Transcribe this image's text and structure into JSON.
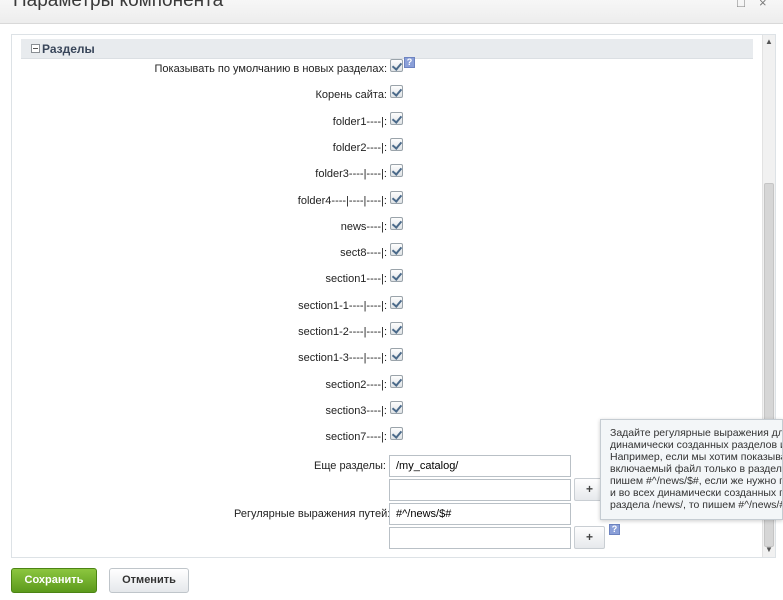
{
  "window": {
    "title": "Параметры компонента",
    "minimize_glyph": "□",
    "close_glyph": "×"
  },
  "section": {
    "title": "Разделы"
  },
  "checkbox_rows": [
    {
      "label": "Показывать по умолчанию в новых разделах:",
      "checked": true
    },
    {
      "label": "Корень сайта:",
      "checked": true
    },
    {
      "label": "folder1----|:",
      "checked": true
    },
    {
      "label": "folder2----|:",
      "checked": true
    },
    {
      "label": "folder3----|----|:",
      "checked": true
    },
    {
      "label": "folder4----|----|----|:",
      "checked": true
    },
    {
      "label": "news----|:",
      "checked": true
    },
    {
      "label": "sect8----|:",
      "checked": true
    },
    {
      "label": "section1----|:",
      "checked": true
    },
    {
      "label": "section1-1----|----|:",
      "checked": true
    },
    {
      "label": "section1-2----|----|:",
      "checked": true
    },
    {
      "label": "section1-3----|----|:",
      "checked": true
    },
    {
      "label": "section2----|:",
      "checked": true
    },
    {
      "label": "section3----|:",
      "checked": true
    },
    {
      "label": "section7----|:",
      "checked": true
    }
  ],
  "more_sections": {
    "label": "Еще разделы:",
    "value1": "/my_catalog/",
    "value2": "",
    "add_label": "+"
  },
  "regex_paths": {
    "label": "Регулярные выражения путей:",
    "value1": "#^/news/$#",
    "value2": "",
    "add_label": "+"
  },
  "help_glyph": "?",
  "tooltip": {
    "lines": [
      "Задайте регулярные выражения для",
      "динамически созданных разделов и",
      "Например, если мы хотим показыват",
      "включаемый файл только в разделе",
      "пишем #^/news/$#, если же нужно по",
      "и во всех динамически созданных под",
      "раздела /news/, то пишем #^/news/#"
    ]
  },
  "scrollbar": {
    "up": "▲",
    "down": "▼"
  },
  "footer": {
    "save_label": "Сохранить",
    "cancel_label": "Отменить"
  },
  "colors": {
    "save_button": "#6aab27",
    "section_header_bg": "#e8ebee"
  }
}
